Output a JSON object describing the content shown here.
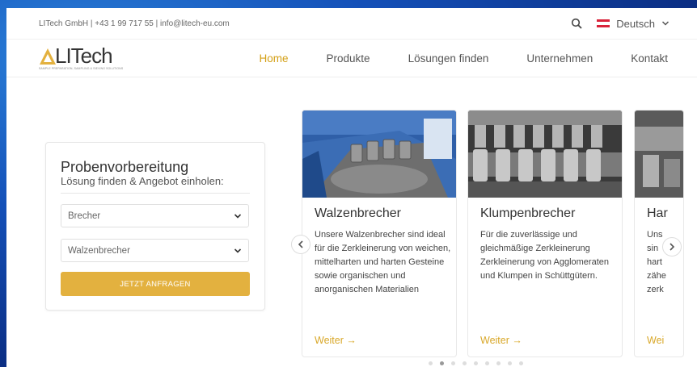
{
  "topbar": {
    "contact": "LITech GmbH | +43 1 99 717 55 | info@litech-eu.com",
    "language": "Deutsch"
  },
  "logo": {
    "name": "LITech",
    "tagline": "SAMPLE PREPARATION, SAMPLING & SIEVING SOLUTIONS"
  },
  "nav": {
    "items": [
      "Home",
      "Produkte",
      "Lösungen finden",
      "Unternehmen",
      "Kontakt"
    ],
    "active": "Home"
  },
  "form": {
    "title": "Probenvorbereitung",
    "subtitle": "Lösung finden & Angebot einholen:",
    "select1_value": "Brecher",
    "select2_value": "Walzenbrecher",
    "cta": "JETZT ANFRAGEN"
  },
  "cards": [
    {
      "title": "Walzenbrecher",
      "text": "Unsere Walzenbrecher sind ideal für die Zerkleinerung von weichen, mittelharten und harten Gesteine sowie organischen und anorganischen Materialien",
      "link": "Weiter →"
    },
    {
      "title": "Klumpenbrecher",
      "text": "Für die zuverlässige und gleichmäßige Zerkleinerung Zerkleinerung von Agglomeraten und Klumpen in Schüttgütern.",
      "link": "Weiter →"
    },
    {
      "title": "Har",
      "text_lines": [
        "Uns",
        "sin",
        "hart",
        "zähe",
        "zerk"
      ],
      "link": "Wei"
    }
  ],
  "carousel": {
    "dot_count": 9,
    "active_index": 1
  },
  "colors": {
    "accent": "#d4a017",
    "button": "#e3b13f",
    "background": "#1450b8"
  }
}
